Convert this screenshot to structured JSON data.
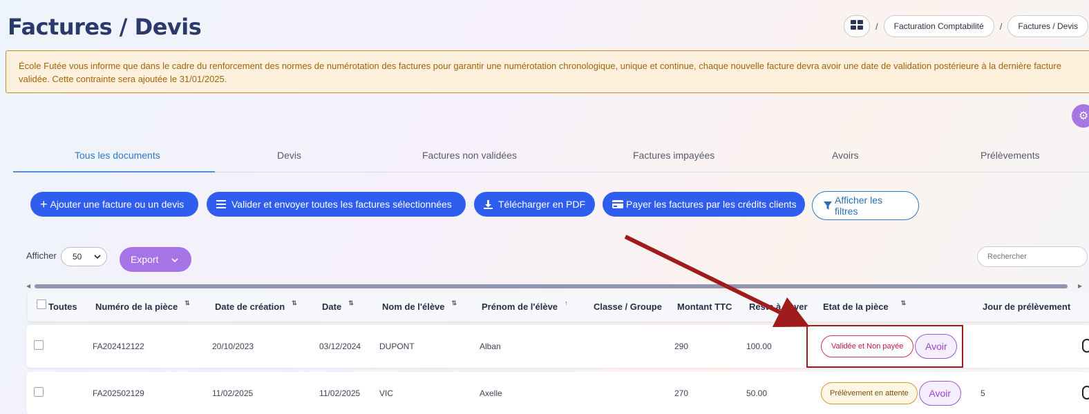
{
  "page": {
    "title": "Factures / Devis"
  },
  "breadcrumb": {
    "home_icon": "dashboard-grid-icon",
    "sep": "/",
    "items": [
      "Facturation Comptabilité",
      "Factures / Devis"
    ]
  },
  "notice": {
    "text": "École Futée vous informe que dans le cadre du renforcement des normes de numérotation des factures pour garantir une numérotation chronologique, unique et continue, chaque nouvelle facture devra avoir une date de validation postérieure à la dernière facture validée. Cette contrainte sera ajoutée le 31/01/2025."
  },
  "tabs": [
    {
      "label": "Tous les documents",
      "active": true
    },
    {
      "label": "Devis"
    },
    {
      "label": "Factures non validées"
    },
    {
      "label": "Factures impayées"
    },
    {
      "label": "Avoirs"
    },
    {
      "label": "Prélèvements"
    }
  ],
  "actions": {
    "add": "Ajouter une facture ou un devis",
    "validate": "Valider et envoyer toutes les factures sélectionnées",
    "pdf": "Télécharger en PDF",
    "pay": "Payer les factures par les crédits clients",
    "filters": "Afficher les filtres"
  },
  "list_controls": {
    "show_label": "Afficher",
    "page_size": "50",
    "export_label": "Export",
    "search_placeholder": "Rechercher"
  },
  "table": {
    "columns": {
      "select_all": "Toutes",
      "number": "Numéro de la pièce",
      "created": "Date de création",
      "date": "Date",
      "last_name": "Nom de l'élève",
      "first_name": "Prénom de l'élève",
      "class": "Classe / Groupe",
      "amount": "Montant TTC",
      "remaining": "Reste à payer",
      "status": "Etat de la pièce",
      "debit_day": "Jour de prélèvement"
    },
    "rows": [
      {
        "number": "FA202412122",
        "created": "20/10/2023",
        "date": "03/12/2024",
        "last_name": "DUPONT",
        "first_name": "Alban",
        "class": "",
        "amount": "290",
        "remaining": "100.00",
        "status": "Validée et Non payée",
        "status_type": "unpaid",
        "action": "Avoir",
        "debit_day": ""
      },
      {
        "number": "FA202502129",
        "created": "11/02/2025",
        "date": "11/02/2025",
        "last_name": "VIC",
        "first_name": "Axelle",
        "class": "",
        "amount": "270",
        "remaining": "50.00",
        "status": "Prélèvement en attente",
        "status_type": "pending",
        "action": "Avoir",
        "debit_day": "5"
      }
    ]
  },
  "colors": {
    "primary": "#2f5ded",
    "accent_purple": "#a674e6",
    "annotation_red": "#a01b1b",
    "notice_bg": "#fdf0dc"
  }
}
